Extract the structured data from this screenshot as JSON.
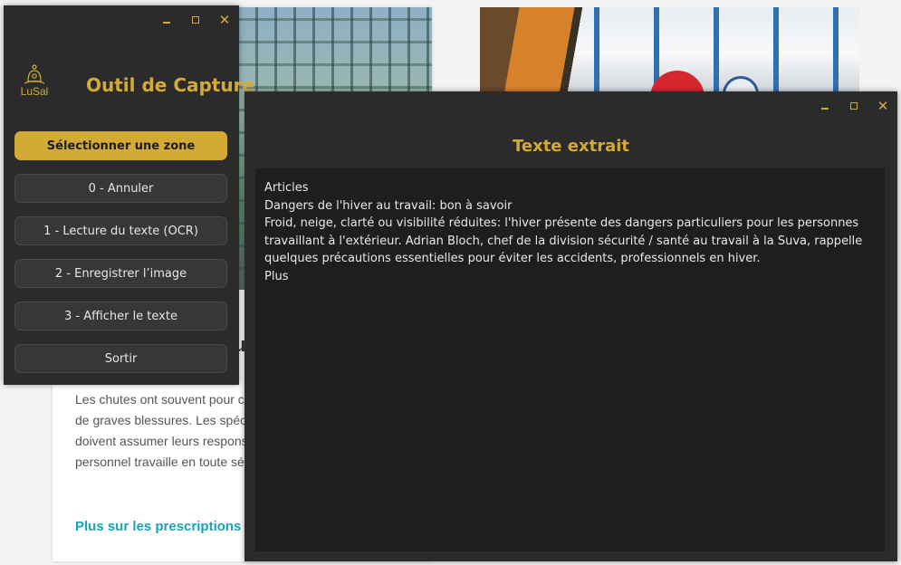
{
  "background_page": {
    "heading_fragment": "u",
    "paragraph_lines": [
      "Les chutes ont souvent pour c",
      "de graves blessures. Les spéc",
      "doivent assumer leurs respons",
      "personnel travaille en toute sé"
    ],
    "link_text": "Plus sur les prescriptions"
  },
  "capture_window": {
    "logo_text": "LuSal",
    "title": "Outil de Capture",
    "buttons": {
      "select_zone": "Sélectionner une zone",
      "cancel": "0 - Annuler",
      "ocr": "1 - Lecture du texte (OCR)",
      "save_image": "2 - Enregistrer l’image",
      "show_text": "3 - Afficher le texte",
      "exit": "Sortir"
    }
  },
  "text_window": {
    "title": "Texte extrait",
    "lines": [
      "Articles",
      "Dangers de l'hiver au travail: bon à savoir",
      "Froid, neige, clarté ou visibilité réduites: l'hiver présente des dangers particuliers pour les personnes travaillant à l'extérieur. Adrian Bloch, chef de la division sécurité / santé au travail à la Suva, rappelle quelques précautions essentielles pour éviter les accidents, professionnels en hiver.",
      "Plus"
    ]
  },
  "colors": {
    "accent": "#d4aa37",
    "window_bg": "#2b2b2b",
    "text_area_bg": "#1e1e1e",
    "link": "#1aa3b8"
  }
}
